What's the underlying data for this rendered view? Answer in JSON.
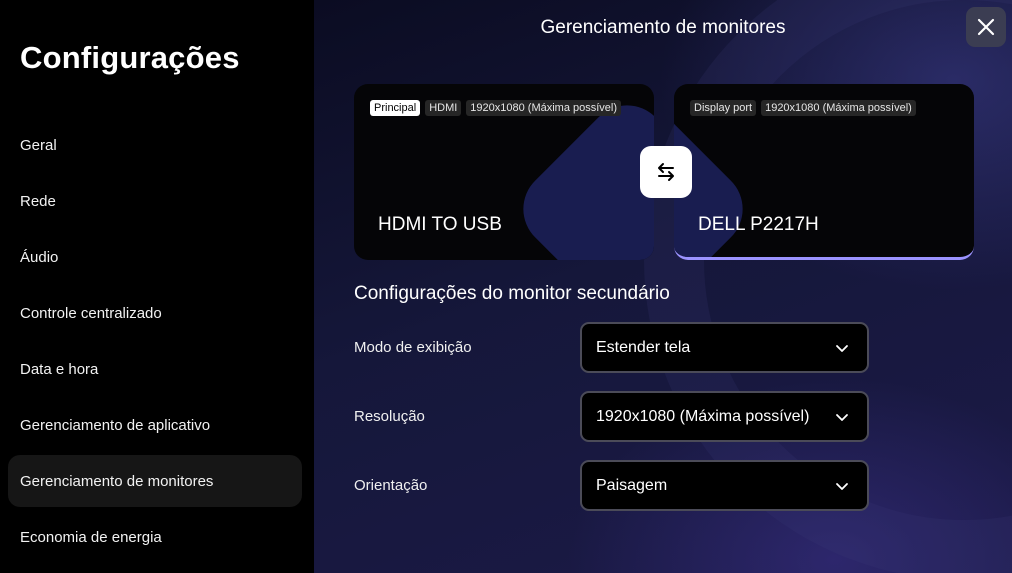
{
  "sidebar": {
    "title": "Configurações",
    "items": [
      {
        "label": "Geral"
      },
      {
        "label": "Rede"
      },
      {
        "label": "Áudio"
      },
      {
        "label": "Controle centralizado"
      },
      {
        "label": "Data e hora"
      },
      {
        "label": "Gerenciamento de aplicativo"
      },
      {
        "label": "Gerenciamento de monitores"
      },
      {
        "label": "Economia de energia"
      }
    ],
    "active_index": 6
  },
  "main": {
    "title": "Gerenciamento de monitores",
    "close_icon": "close-icon",
    "monitors": [
      {
        "badges": [
          "Principal",
          "HDMI",
          "1920x1080 (Máxima possível)"
        ],
        "name": "HDMI TO USB"
      },
      {
        "badges": [
          "Display port",
          "1920x1080 (Máxima possível)"
        ],
        "name": "DELL P2217H"
      }
    ],
    "swap_icon": "swap-arrows-icon",
    "section_title": "Configurações do monitor secundário",
    "settings": [
      {
        "label": "Modo de exibição",
        "value": "Estender tela"
      },
      {
        "label": "Resolução",
        "value": "1920x1080 (Máxima possível)"
      },
      {
        "label": "Orientação",
        "value": "Paisagem"
      }
    ]
  },
  "colors": {
    "accent": "#9b93ff",
    "sidebar_bg": "#000000",
    "active_item_bg": "#161616",
    "card_bg": "#050507"
  }
}
